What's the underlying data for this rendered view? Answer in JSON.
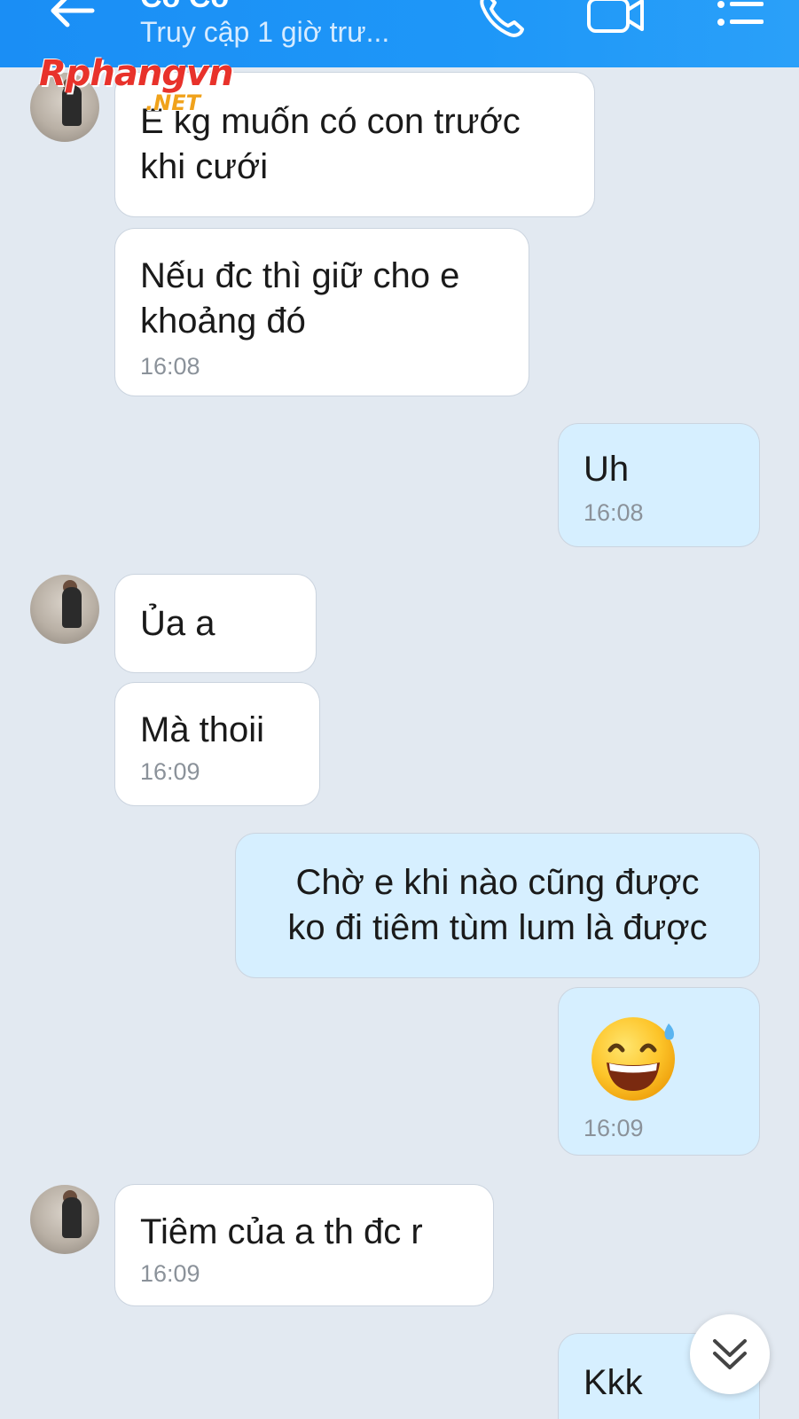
{
  "header": {
    "contact_name": "Cô Cô",
    "status": "Truy cập 1 giờ trư...",
    "icons": {
      "back": "back-arrow-icon",
      "call": "phone-icon",
      "video": "video-camera-icon",
      "menu": "list-menu-icon"
    }
  },
  "watermark": {
    "main": "Rphangvn",
    "sub": ".NET"
  },
  "messages": [
    {
      "side": "in",
      "text": "E kg muốn có con trước\nkhi cưới",
      "time": ""
    },
    {
      "side": "in",
      "text": "Nếu đc thì giữ cho e\nkhoảng đó",
      "time": "16:08"
    },
    {
      "side": "out",
      "text": "Uh",
      "time": "16:08"
    },
    {
      "side": "in",
      "text": "Ủa a",
      "time": ""
    },
    {
      "side": "in",
      "text": "Mà thoii",
      "time": "16:09"
    },
    {
      "side": "out",
      "text": "Chờ e khi nào cũng được\nko đi tiêm tùm lum là được",
      "time": ""
    },
    {
      "side": "out",
      "text": "😅",
      "time": "16:09",
      "emoji": "grinning-sweat-emoji"
    },
    {
      "side": "in",
      "text": "Tiêm của a th đc r",
      "time": "16:09"
    },
    {
      "side": "out",
      "text": "Kkk",
      "time": ""
    }
  ],
  "colors": {
    "header": "#1e97f8",
    "background": "#e2e9f1",
    "incoming": "#ffffff",
    "outgoing": "#d6efff",
    "time": "#8b929a"
  },
  "scroll_button_icon": "double-chevron-down-icon"
}
